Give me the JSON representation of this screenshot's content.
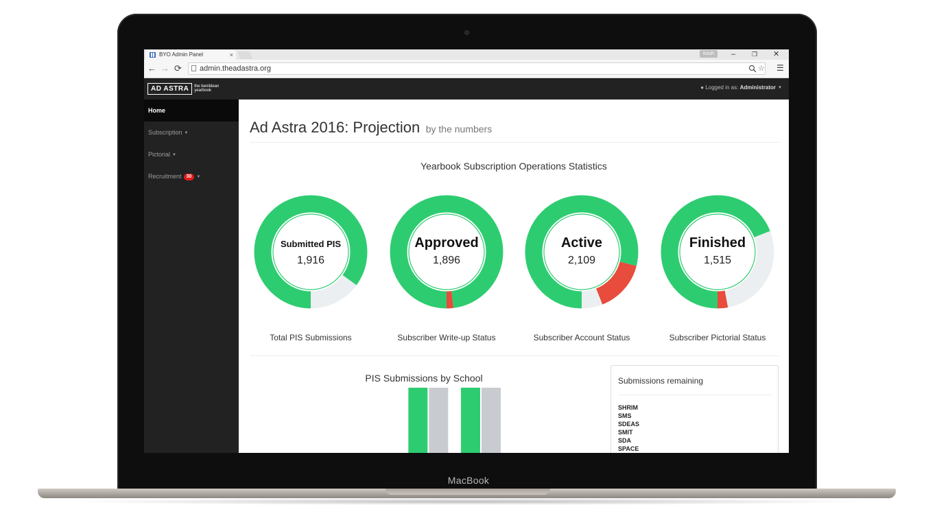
{
  "device": {
    "label": "MacBook"
  },
  "browser": {
    "tab_title": "BYO Admin Panel",
    "tab_close": "×",
    "profile_name": "Kesh",
    "url": "admin.theadastra.org",
    "controls": {
      "minimize": "–",
      "restore": "❐",
      "close": "✕"
    }
  },
  "app": {
    "brand_main": "AD ASTRA",
    "brand_sub": "the benildean yearbook",
    "login_prefix": "Logged in as:",
    "login_user": "Administrator"
  },
  "sidebar": {
    "items": [
      {
        "label": "Home"
      },
      {
        "label": "Subscription"
      },
      {
        "label": "Pictorial"
      },
      {
        "label": "Recruitment",
        "badge": "30"
      }
    ]
  },
  "page": {
    "title": "Ad Astra 2016: Projection",
    "subtitle": "by the numbers",
    "stats_title": "Yearbook Subscription Operations Statistics"
  },
  "donuts": [
    {
      "title": "Submitted PIS",
      "value": "1,916",
      "label": "Total PIS Submissions",
      "segments": [
        {
          "fraction": 0.85,
          "color": "#2ecc71"
        },
        {
          "fraction": 0.15,
          "color": "#eceff1"
        }
      ]
    },
    {
      "title": "Approved",
      "value": "1,896",
      "label": "Subscriber Write-up Status",
      "segments": [
        {
          "fraction": 0.98,
          "color": "#2ecc71"
        },
        {
          "fraction": 0.02,
          "color": "#e74c3c"
        }
      ]
    },
    {
      "title": "Active",
      "value": "2,109",
      "label": "Subscriber Account Status",
      "segments": [
        {
          "fraction": 0.79,
          "color": "#2ecc71"
        },
        {
          "fraction": 0.15,
          "color": "#e74c3c"
        },
        {
          "fraction": 0.06,
          "color": "#eceff1"
        }
      ]
    },
    {
      "title": "Finished",
      "value": "1,515",
      "label": "Subscriber Pictorial Status",
      "segments": [
        {
          "fraction": 0.69,
          "color": "#2ecc71"
        },
        {
          "fraction": 0.28,
          "color": "#eceff1"
        },
        {
          "fraction": 0.03,
          "color": "#e74c3c"
        }
      ]
    }
  ],
  "bar_chart_title": "PIS Submissions by School",
  "chart_data": {
    "type": "bar",
    "title": "PIS Submissions by School",
    "categories": [
      "",
      "",
      "",
      "",
      "",
      ""
    ],
    "series": [
      {
        "values": [
          0,
          0,
          0,
          570,
          740,
          0
        ],
        "color": "#2ecc71"
      },
      {
        "values": [
          0,
          0,
          0,
          580,
          680,
          0
        ],
        "color": "#c8ccd0"
      }
    ],
    "yticks": [
      "800",
      "600"
    ],
    "ylim": [
      0,
      850
    ],
    "grid": true
  },
  "remaining": {
    "title": "Submissions remaining",
    "items": [
      "SHRIM",
      "SMS",
      "SDEAS",
      "SMIT",
      "SDA",
      "SPACE"
    ]
  }
}
